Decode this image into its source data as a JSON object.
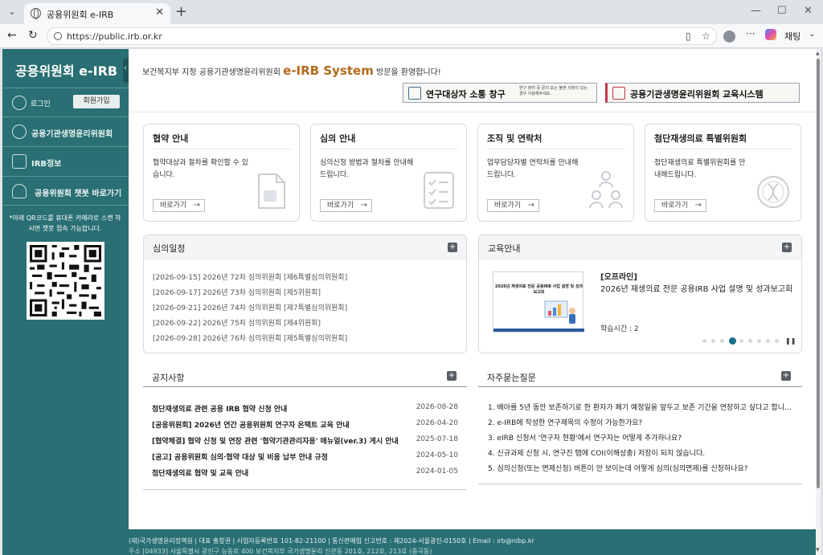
{
  "browser": {
    "tab_title": "공용위원회 e-IRB",
    "url": "https://public.irb.or.kr",
    "copilot_label": "채팅"
  },
  "sidebar": {
    "brand": "공용위원회 e-IRB",
    "login_label": "로그인",
    "signup_label": "회원가입",
    "items": [
      {
        "label": "공용기관생명윤리위원회",
        "icon": "people-icon"
      },
      {
        "label": "IRB정보",
        "icon": "edit-icon"
      },
      {
        "label": "공용위원회 챗봇 바로가기",
        "icon": "chatbot-icon"
      }
    ],
    "qr_note": "*아래 QR코드를 휴대폰 카메라로 스캔 하시면 챗봇 접속 가능합니다."
  },
  "header": {
    "welcome_prefix": "보건복지부 지정 공용기관생명윤리위원회",
    "welcome_system": "e-IRB System",
    "welcome_suffix": "방문을 환영합니다!",
    "banner1_title": "연구대상자 소통 창구",
    "banner1_sub": "연구 참여 중 문의 또는 불편 사항이 있는 경우 이용해주세요.",
    "banner2_title": "공용기관생명윤리위원회 교육시스템"
  },
  "cards": [
    {
      "title": "협약 안내",
      "desc": "협약대상과 절차를 확인할 수 있습니다.",
      "button": "바로가기",
      "icon": "document-icon"
    },
    {
      "title": "심의 안내",
      "desc": "심의신청 방법과 절차를 안내해드립니다.",
      "button": "바로가기",
      "icon": "checklist-icon"
    },
    {
      "title": "조직 및 연락처",
      "desc": "업무담당자별 연락처를 안내해드립니다.",
      "button": "바로가기",
      "icon": "org-icon"
    },
    {
      "title": "첨단재생의료 특별위원회",
      "desc": "첨단재생의료 특별위원회를 안내해드립니다.",
      "button": "바로가기",
      "icon": "dna-icon"
    }
  ],
  "schedule": {
    "title": "심의일정",
    "items": [
      "[2026-09-15] 2026년 72차 심의위원회 [제6특별심의위원회]",
      "[2026-09-17] 2026년 73차 심의위원회 [제5위원회]",
      "[2026-09-21] 2026년 74차 심의위원회 [제7특별심의위원회]",
      "[2026-09-22] 2026년 75차 심의위원회 [제4위원회]",
      "[2026-09-28] 2026년 76차 심의위원회 [제5특별심의위원회]"
    ]
  },
  "education": {
    "title": "교육안내",
    "thumb_title": "2026년 재생의료 전문 공용IRB 사업 설명 및 성과보고회",
    "tag": "[오프라인]",
    "name": "2026년 재생의료 전문 공용IRB 사업 설명 및 성과보고회",
    "time": "학습시간 : 2",
    "slide_count": 9,
    "active_slide": 3
  },
  "notices": {
    "title": "공지사항",
    "items": [
      {
        "text": "첨단재생의료 관련 공용 IRB 협약 신청 안내",
        "date": "2026-08-28"
      },
      {
        "text": "[공용위원회] 2026년 연간 공용위원회 연구자 온택트 교육 안내",
        "date": "2026-04-20"
      },
      {
        "text": "[협약체결] 협약 신청 및 연장 관련 '협약기관관리자용' 매뉴얼(ver.3) 게시 안내",
        "date": "2025-07-18"
      },
      {
        "text": "[공고] 공용위원회 심의·협약 대상 및 비용 납부 안내 규정",
        "date": "2024-05-10"
      },
      {
        "text": "첨단재생의료 협약 및 교육 안내",
        "date": "2024-01-05"
      }
    ]
  },
  "faq": {
    "title": "자주묻는질문",
    "items": [
      "1. 배아를 5년 동안 보존하기로 한 환자가 폐기 예정일을 앞두고 보존 기간을 연장하고 싶다고 합니다.",
      "2. e-IRB에 작성한 연구제목의 수정이 가능한가요?",
      "3. eIRB 신청서 '연구자 현황'에서 연구자는 어떻게 추가하나요?",
      "4. 신규과제 신청 시, 연구진 탭에 COI(이해상충) 저장이 되지 않습니다.",
      "5. 심의신청(또는 면제신청) 버튼이 안 보이는데 어떻게 심의(심의면제)를 신청하나요?"
    ]
  },
  "footer": {
    "line1": "(재)국가생명윤리정책원  |  대표 홍창권  |  사업자등록번호 101-82-21100  |  통신판매업 신고번호 : 제2024-서울광진-0150호  |  Email : irb@nibp.kr",
    "line2": "주소 [04933] 서울특별시 광진구 능동로 400 보건복지부 국가생명윤리 신관동 201호, 212호, 213호 (중곡동)"
  }
}
